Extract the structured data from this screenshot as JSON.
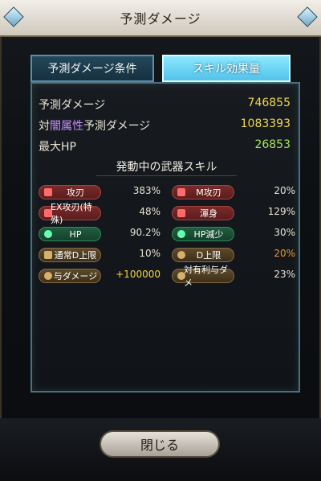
{
  "window": {
    "title": "予測ダメージ"
  },
  "tabs": [
    {
      "label": "予測ダメージ条件"
    },
    {
      "label": "スキル効果量"
    }
  ],
  "summary": {
    "predicted_damage": {
      "label": "予測ダメージ",
      "value": "746855"
    },
    "dark_predicted_damage": {
      "label_prefix": "対",
      "label_attr": "闇属性",
      "label_suffix": "予測ダメージ",
      "value": "1083393"
    },
    "max_hp": {
      "label": "最大HP",
      "value": "26853"
    }
  },
  "skills_section": {
    "title": "発動中の武器スキル"
  },
  "skills": [
    {
      "name": "攻刃",
      "value": "383%",
      "color": "red",
      "icon": "sword-icon"
    },
    {
      "name": "M攻刃",
      "value": "20%",
      "color": "red",
      "icon": "sword-icon"
    },
    {
      "name": "EX攻刃(特殊)",
      "value": "48%",
      "color": "red",
      "icon": "sword-icon"
    },
    {
      "name": "渾身",
      "value": "129%",
      "color": "red",
      "icon": "arm-icon"
    },
    {
      "name": "HP",
      "value": "90.2%",
      "color": "green",
      "icon": "heart-icon"
    },
    {
      "name": "HP減少",
      "value": "30%",
      "color": "green",
      "icon": "heart-icon"
    },
    {
      "name": "通常D上限",
      "value": "10%",
      "color": "brown",
      "icon": "cap-icon"
    },
    {
      "name": "D上限",
      "value": "20%",
      "color": "brown",
      "icon": "gear-icon"
    },
    {
      "name": "与ダメージ",
      "value": "+100000",
      "color": "brown",
      "icon": "gear-icon"
    },
    {
      "name": "対有利与ダメ",
      "value": "23%",
      "color": "brown",
      "icon": "gear-icon"
    }
  ],
  "footer": {
    "close_label": "閉じる"
  },
  "palette": {
    "yellow": "#f2d74a",
    "green": "#a9e35d",
    "dark_attr": "#c78cff",
    "tab_active": "#52c3ea"
  }
}
